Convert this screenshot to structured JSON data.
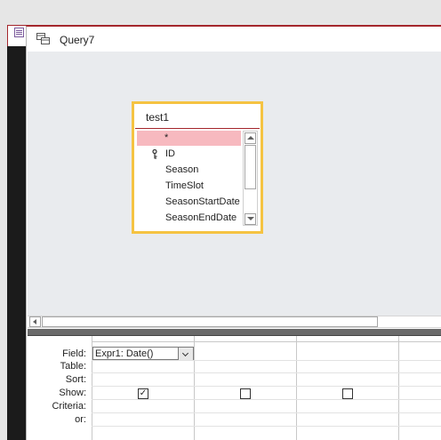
{
  "query_window": {
    "title": "Query7"
  },
  "table": {
    "name": "test1",
    "fields": [
      {
        "label": "*",
        "selected": true,
        "key": false
      },
      {
        "label": "ID",
        "selected": false,
        "key": true
      },
      {
        "label": "Season",
        "selected": false,
        "key": false
      },
      {
        "label": "TimeSlot",
        "selected": false,
        "key": false
      },
      {
        "label": "SeasonStartDate",
        "selected": false,
        "key": false
      },
      {
        "label": "SeasonEndDate",
        "selected": false,
        "key": false
      }
    ]
  },
  "design_grid": {
    "row_labels": {
      "field": "Field:",
      "table": "Table:",
      "sort": "Sort:",
      "show": "Show:",
      "criteria": "Criteria:",
      "or": "or:"
    },
    "columns": [
      {
        "field": "Expr1: Date()",
        "show": true
      },
      {
        "field": "",
        "show": false
      },
      {
        "field": "",
        "show": false
      }
    ]
  },
  "colors": {
    "accent": "#a4262c",
    "table_highlight": "#f5c342",
    "selected_row": "#f7b9bf"
  }
}
